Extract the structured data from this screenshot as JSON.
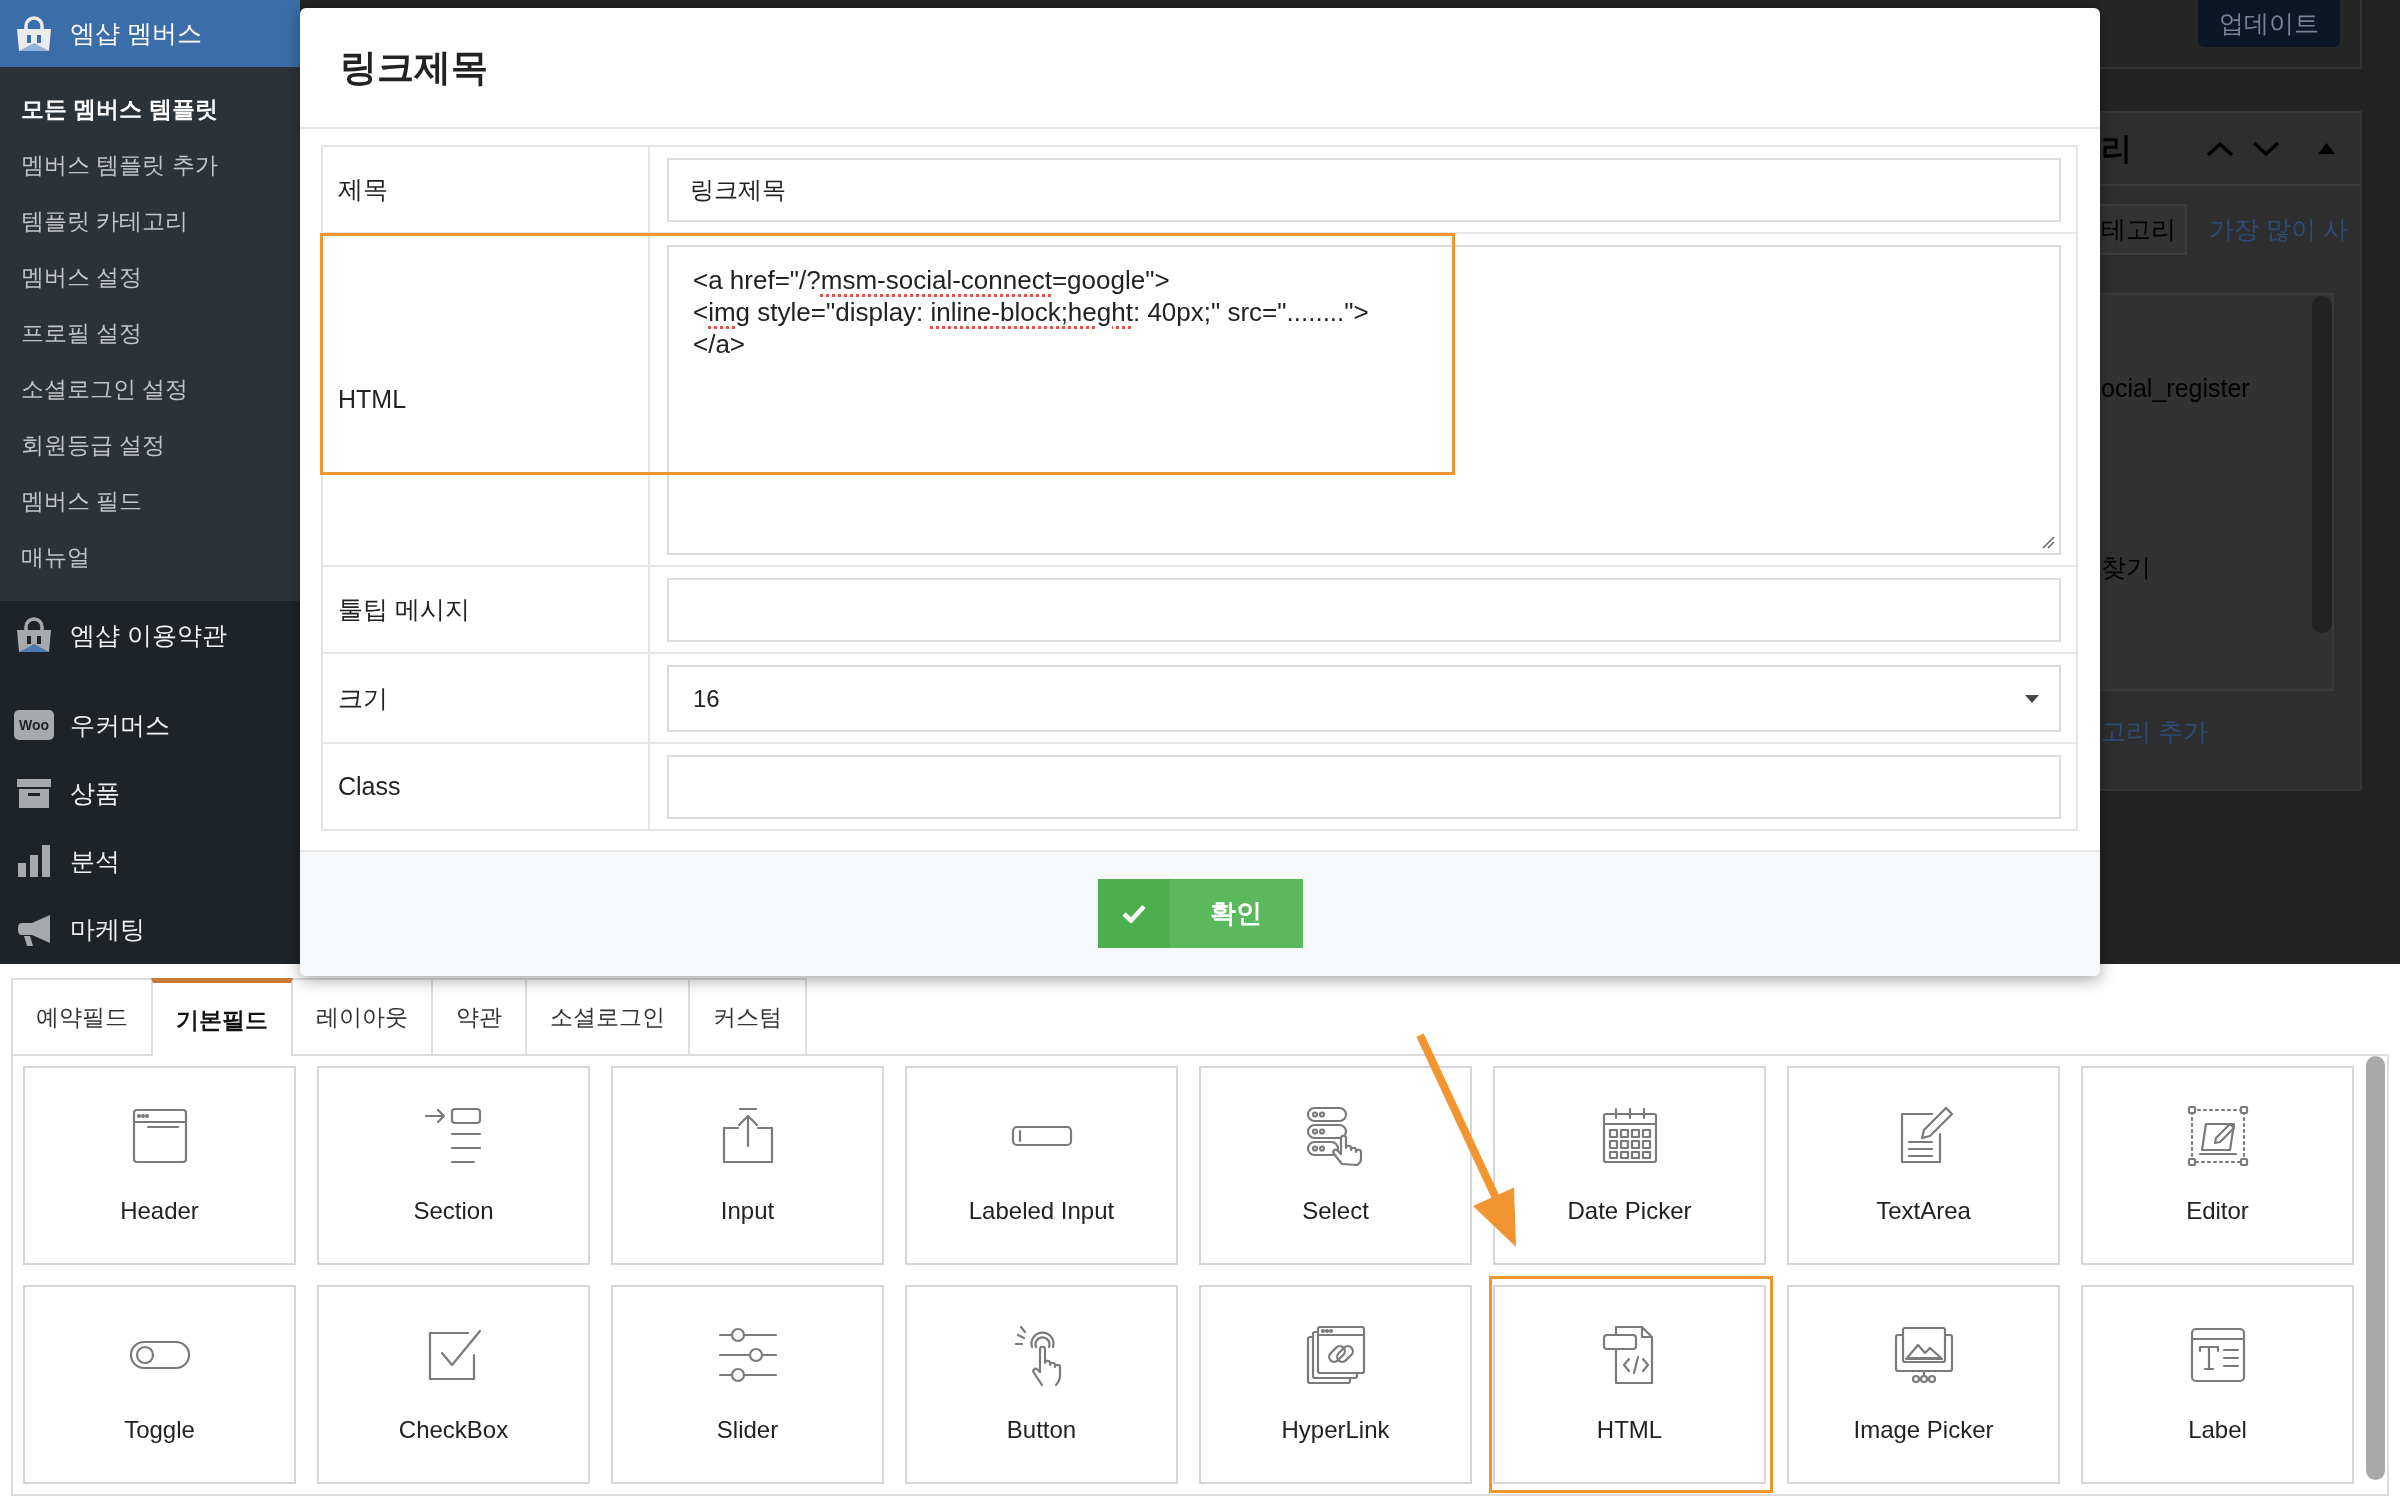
{
  "sidebar": {
    "menu": [
      {
        "label": "엠샵 멤버스",
        "selected": true,
        "submenu": [
          {
            "label": "모든 멤버스 템플릿",
            "selected": true
          },
          {
            "label": "멤버스 템플릿 추가",
            "selected": false
          },
          {
            "label": "템플릿 카테고리",
            "selected": false
          },
          {
            "label": "멤버스 설정",
            "selected": false
          },
          {
            "label": "프로필 설정",
            "selected": false
          },
          {
            "label": "소셜로그인 설정",
            "selected": false
          },
          {
            "label": "회원등급 설정",
            "selected": false
          },
          {
            "label": "멤버스 필드",
            "selected": false
          },
          {
            "label": "매뉴얼",
            "selected": false
          }
        ]
      },
      {
        "label": "엠샵 이용약관",
        "selected": false
      },
      {
        "label": "우커머스",
        "selected": false,
        "logo_text": "Woo"
      },
      {
        "label": "상품",
        "selected": false
      },
      {
        "label": "분석",
        "selected": false
      },
      {
        "label": "마케팅",
        "selected": false
      }
    ]
  },
  "background": {
    "update_button": "업데이트",
    "panel_title": "리",
    "tabs": [
      {
        "label": "테고리",
        "selected": true
      },
      {
        "label": "가장 많이 사",
        "selected": false
      }
    ],
    "list_items": [
      "ocial_register",
      "찾기"
    ],
    "add_link": "고리 추가"
  },
  "modal": {
    "title": "링크제목",
    "fields": [
      {
        "label": "제목",
        "kind": "input",
        "value": "링크제목"
      },
      {
        "label": "HTML",
        "kind": "textarea",
        "highlighted": true,
        "lines": [
          {
            "segments": [
              {
                "text": "<a href=\"/?",
                "misspelled": false
              },
              {
                "text": "msm-social-connect",
                "misspelled": true
              },
              {
                "text": "=google\">",
                "misspelled": false
              }
            ]
          },
          {
            "segments": [
              {
                "text": "<",
                "misspelled": false
              },
              {
                "text": "img",
                "misspelled": true
              },
              {
                "text": " style=\"display: ",
                "misspelled": false
              },
              {
                "text": "inline-block;heght",
                "misspelled": true
              },
              {
                "text": ": 40px;\" src=\"........\">",
                "misspelled": false
              }
            ]
          },
          {
            "segments": [
              {
                "text": "</a>",
                "misspelled": false
              }
            ]
          }
        ]
      },
      {
        "label": "툴팁 메시지",
        "kind": "input"
      },
      {
        "label": "크기",
        "kind": "select",
        "value": "16"
      },
      {
        "label": "Class",
        "kind": "input"
      }
    ],
    "confirm_button": "확인"
  },
  "palette": {
    "tabs": [
      {
        "label": "예약필드",
        "selected": false
      },
      {
        "label": "기본필드",
        "selected": true
      },
      {
        "label": "레이아웃",
        "selected": false
      },
      {
        "label": "약관",
        "selected": false
      },
      {
        "label": "소셜로그인",
        "selected": false
      },
      {
        "label": "커스텀",
        "selected": false
      }
    ],
    "items": [
      {
        "label": "Header"
      },
      {
        "label": "Section"
      },
      {
        "label": "Input"
      },
      {
        "label": "Labeled Input"
      },
      {
        "label": "Select"
      },
      {
        "label": "Date Picker"
      },
      {
        "label": "TextArea"
      },
      {
        "label": "Editor"
      },
      {
        "label": "Toggle"
      },
      {
        "label": "CheckBox"
      },
      {
        "label": "Slider"
      },
      {
        "label": "Button"
      },
      {
        "label": "HyperLink"
      },
      {
        "label": "HTML",
        "highlighted": true
      },
      {
        "label": "Image Picker"
      },
      {
        "label": "Label"
      }
    ]
  }
}
